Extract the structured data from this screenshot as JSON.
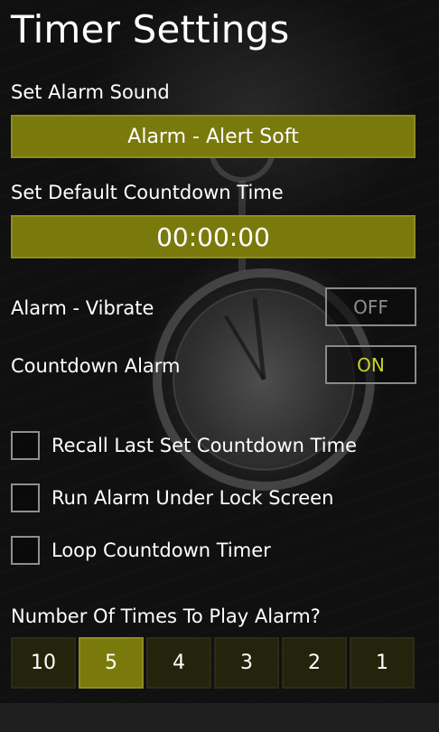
{
  "page": {
    "title": "Timer Settings"
  },
  "alarm_sound": {
    "label": "Set Alarm Sound",
    "value": "Alarm - Alert Soft"
  },
  "countdown_time": {
    "label": "Set Default Countdown Time",
    "value": "00:00:00"
  },
  "toggles": [
    {
      "label": "Alarm - Vibrate",
      "state": "OFF"
    },
    {
      "label": "Countdown Alarm",
      "state": "ON"
    }
  ],
  "checkboxes": [
    {
      "label": "Recall Last Set Countdown Time",
      "checked": false
    },
    {
      "label": "Run Alarm Under Lock Screen",
      "checked": false
    },
    {
      "label": "Loop Countdown Timer",
      "checked": false
    }
  ],
  "play_count": {
    "label": "Number Of Times To Play Alarm?",
    "options": [
      "10",
      "5",
      "4",
      "3",
      "2",
      "1"
    ],
    "selected": "5"
  },
  "colors": {
    "accent": "#7a7a0c",
    "on_text": "#c7d32a",
    "off_text": "#8e8e8e"
  }
}
